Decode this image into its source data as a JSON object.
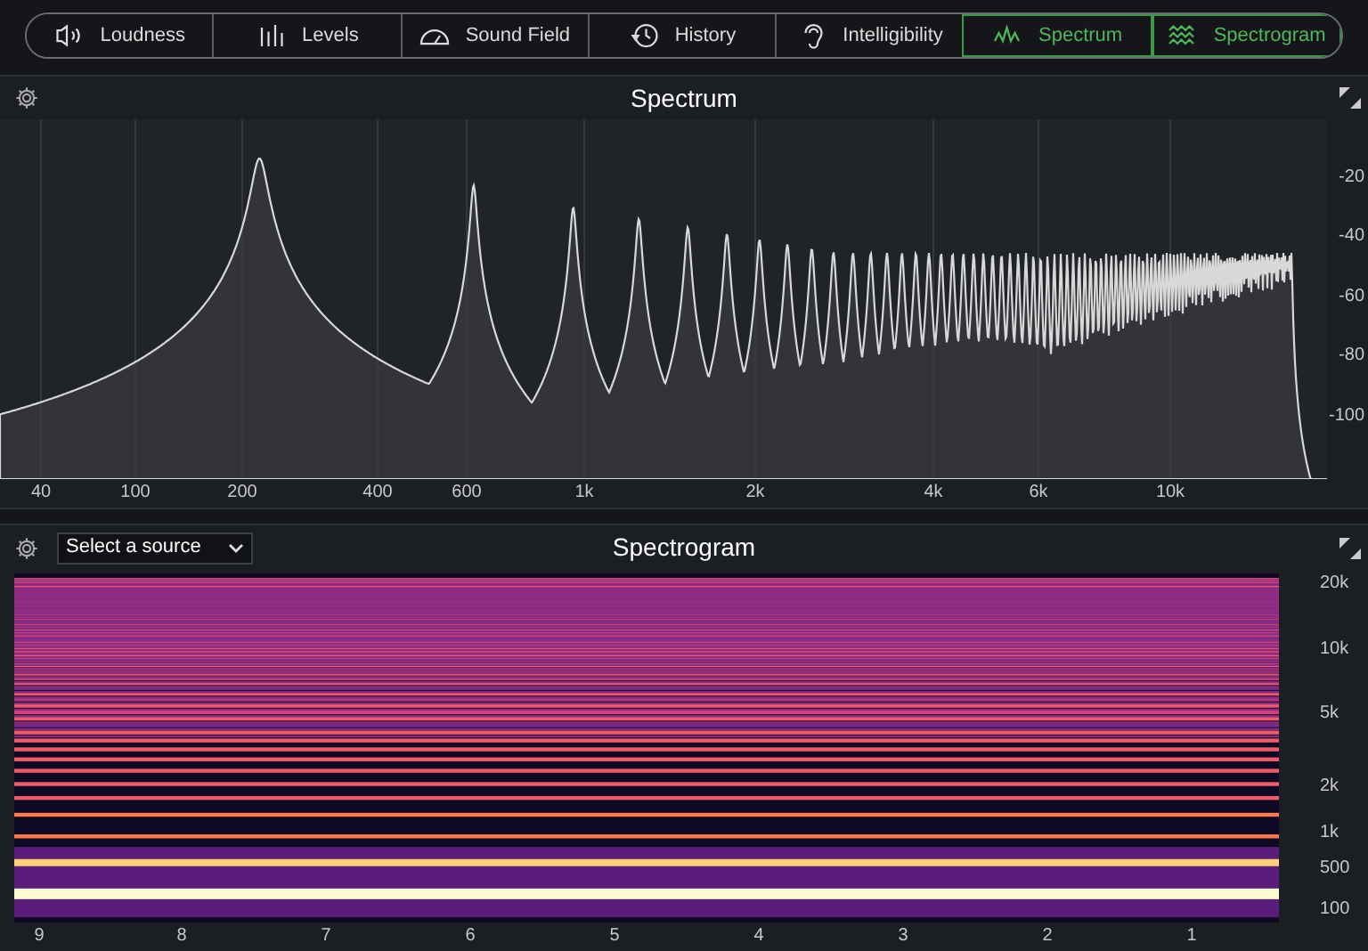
{
  "tabs": [
    {
      "label": "Loudness",
      "selected": false
    },
    {
      "label": "Levels",
      "selected": false
    },
    {
      "label": "Sound Field",
      "selected": false
    },
    {
      "label": "History",
      "selected": false
    },
    {
      "label": "Intelligibility",
      "selected": false
    },
    {
      "label": "Spectrum",
      "selected": true
    },
    {
      "label": "Spectrogram",
      "selected": true
    }
  ],
  "spectrum": {
    "title": "Spectrum",
    "y_axis_labels": [
      "-20",
      "-40",
      "-60",
      "-80",
      "-100"
    ],
    "x_axis_labels": [
      "40",
      "100",
      "200",
      "400",
      "600",
      "1k",
      "2k",
      "4k",
      "6k",
      "10k"
    ]
  },
  "spectrogram": {
    "title": "Spectrogram",
    "source_select": {
      "value": "Select a source"
    },
    "y_axis_labels": [
      "20k",
      "10k",
      "5k",
      "2k",
      "1k",
      "500",
      "100"
    ],
    "x_axis_labels": [
      "9",
      "8",
      "7",
      "6",
      "5",
      "4",
      "3",
      "2",
      "1"
    ]
  }
}
